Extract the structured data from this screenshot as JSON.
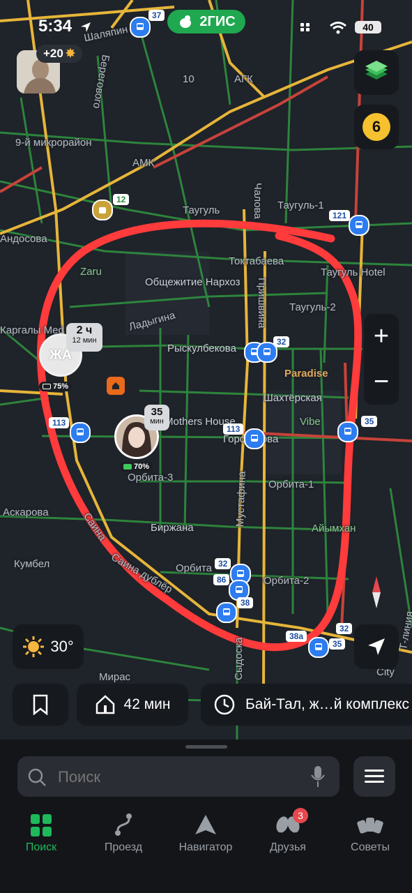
{
  "status_bar": {
    "time": "5:34",
    "app_badge": "2ГИС",
    "battery": "40"
  },
  "map": {
    "labels": {
      "shalyapin": "Шаляпин",
      "beregovogo": "Берегового",
      "agk": "АГК",
      "ten": "10",
      "mikro9": "9-й микрорайон",
      "amk": "АМК",
      "taugul": "Таугуль",
      "taugul1": "Таугуль-1",
      "chalova": "Чалова",
      "zaru": "Zaru",
      "toktabaeva": "Токтабаева",
      "taugul_hotel": "Таугуль Hotel",
      "obshchezhitie": "Общежитие Нархоз",
      "prishvina": "Пришвина",
      "ladygina": "Ладыгина",
      "taugul2": "Таугуль-2",
      "kargaly": "Каргалы Med",
      "ryskulbekova": "Рыскулбекова",
      "paradise": "Paradise",
      "shakhterskaya": "Шахтёрская",
      "mothers_house": "Mothers House",
      "gorodskova": "Городскова",
      "vibe": "Vibe",
      "orbita3": "Орбита-3",
      "orbita1": "Орбита-1",
      "mustafina": "Мустафина",
      "askarova": "Аскарова",
      "birzhana": "Биржана",
      "ayimkhan": "Айымхан",
      "saina": "Саина",
      "saina_dubler": "Саина дублёр",
      "orbita": "Орбита",
      "orbita2": "Орбита-2",
      "kumbel": "Кумбел",
      "miras": "Мирас",
      "sydovska": "Сыдоска",
      "andosova": "Андосова",
      "tlinia": "Т-линия",
      "city": "City"
    },
    "route_numbers": {
      "r37": "37",
      "r12": "12",
      "r121": "121",
      "r113a": "113",
      "r113b": "113",
      "r32a": "32",
      "r32b": "32",
      "r86": "86",
      "r38": "38",
      "r38a": "38а",
      "r35a": "35",
      "r35b": "35",
      "r32c": "32"
    },
    "friend_large": {
      "initials": "ЖА",
      "eta_value": "2 ч",
      "eta_sub": "12 мин",
      "battery": "75%"
    },
    "friend_photo": {
      "eta_value": "35",
      "eta_sub": "мин",
      "battery": "70%"
    }
  },
  "controls": {
    "score": "+20",
    "notifications_count": "6",
    "zoom_in": "+",
    "zoom_out": "−",
    "temperature": "30°"
  },
  "chips": {
    "home_time": "42 мин",
    "recent_place": "Бай-Тал, ж…й комплекс"
  },
  "search": {
    "placeholder": "Поиск"
  },
  "tabs": [
    {
      "label": "Поиск",
      "icon": "grid-icon"
    },
    {
      "label": "Проезд",
      "icon": "route-icon"
    },
    {
      "label": "Навигатор",
      "icon": "navigator-icon"
    },
    {
      "label": "Друзья",
      "icon": "friends-icon",
      "badge": "3"
    },
    {
      "label": "Советы",
      "icon": "cards-icon"
    }
  ],
  "colors": {
    "accent": "#1fb85a",
    "annotation": "#ff3b3b",
    "traffic_slow": "#e6b53a",
    "traffic_jam": "#c7433a",
    "traffic_free": "#2f8f3f"
  }
}
